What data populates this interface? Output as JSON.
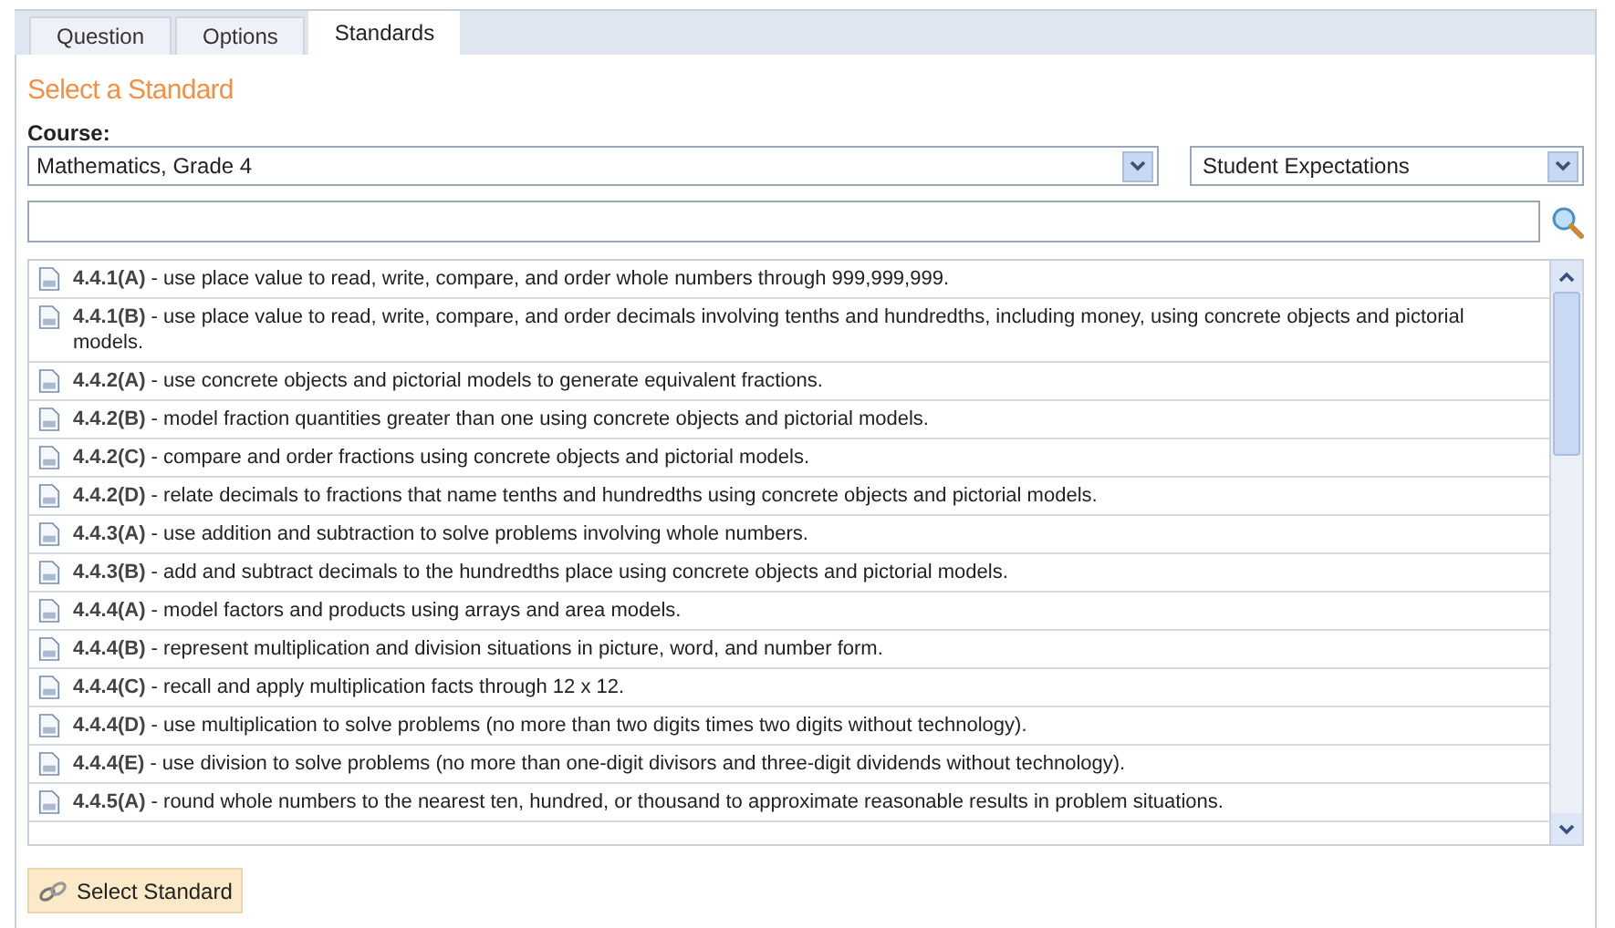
{
  "tabs": [
    {
      "label": "Question",
      "selected": false
    },
    {
      "label": "Options",
      "selected": false
    },
    {
      "label": "Standards",
      "selected": true
    }
  ],
  "heading": "Select a Standard",
  "course": {
    "label": "Course:",
    "value": "Mathematics, Grade 4"
  },
  "type_select": {
    "value": "Student Expectations"
  },
  "standards": [
    {
      "code": "4.4.1(A)",
      "text": " - use place value to read, write, compare, and order whole numbers through 999,999,999."
    },
    {
      "code": "4.4.1(B)",
      "text": " - use place value to read, write, compare, and order decimals involving tenths and hundredths, including money, using concrete objects and pictorial models."
    },
    {
      "code": "4.4.2(A)",
      "text": " - use concrete objects and pictorial models to generate equivalent fractions."
    },
    {
      "code": "4.4.2(B)",
      "text": " - model fraction quantities greater than one using concrete objects and pictorial models."
    },
    {
      "code": "4.4.2(C)",
      "text": " - compare and order fractions using concrete objects and pictorial models."
    },
    {
      "code": "4.4.2(D)",
      "text": " - relate decimals to fractions that name tenths and hundredths using concrete objects and pictorial models."
    },
    {
      "code": "4.4.3(A)",
      "text": " - use addition and subtraction to solve problems involving whole numbers."
    },
    {
      "code": "4.4.3(B)",
      "text": " - add and subtract decimals to the hundredths place using concrete objects and pictorial models."
    },
    {
      "code": "4.4.4(A)",
      "text": " - model factors and products using arrays and area models."
    },
    {
      "code": "4.4.4(B)",
      "text": " - represent multiplication and division situations in picture, word, and number form."
    },
    {
      "code": "4.4.4(C)",
      "text": " - recall and apply multiplication facts through 12 x 12."
    },
    {
      "code": "4.4.4(D)",
      "text": " - use multiplication to solve problems (no more than two digits times two digits without technology)."
    },
    {
      "code": "4.4.4(E)",
      "text": " - use division to solve problems (no more than one-digit divisors and three-digit dividends without technology)."
    },
    {
      "code": "4.4.5(A)",
      "text": " - round whole numbers to the nearest ten, hundred, or thousand to approximate reasonable results in problem situations."
    }
  ],
  "action_button": "Select Standard"
}
